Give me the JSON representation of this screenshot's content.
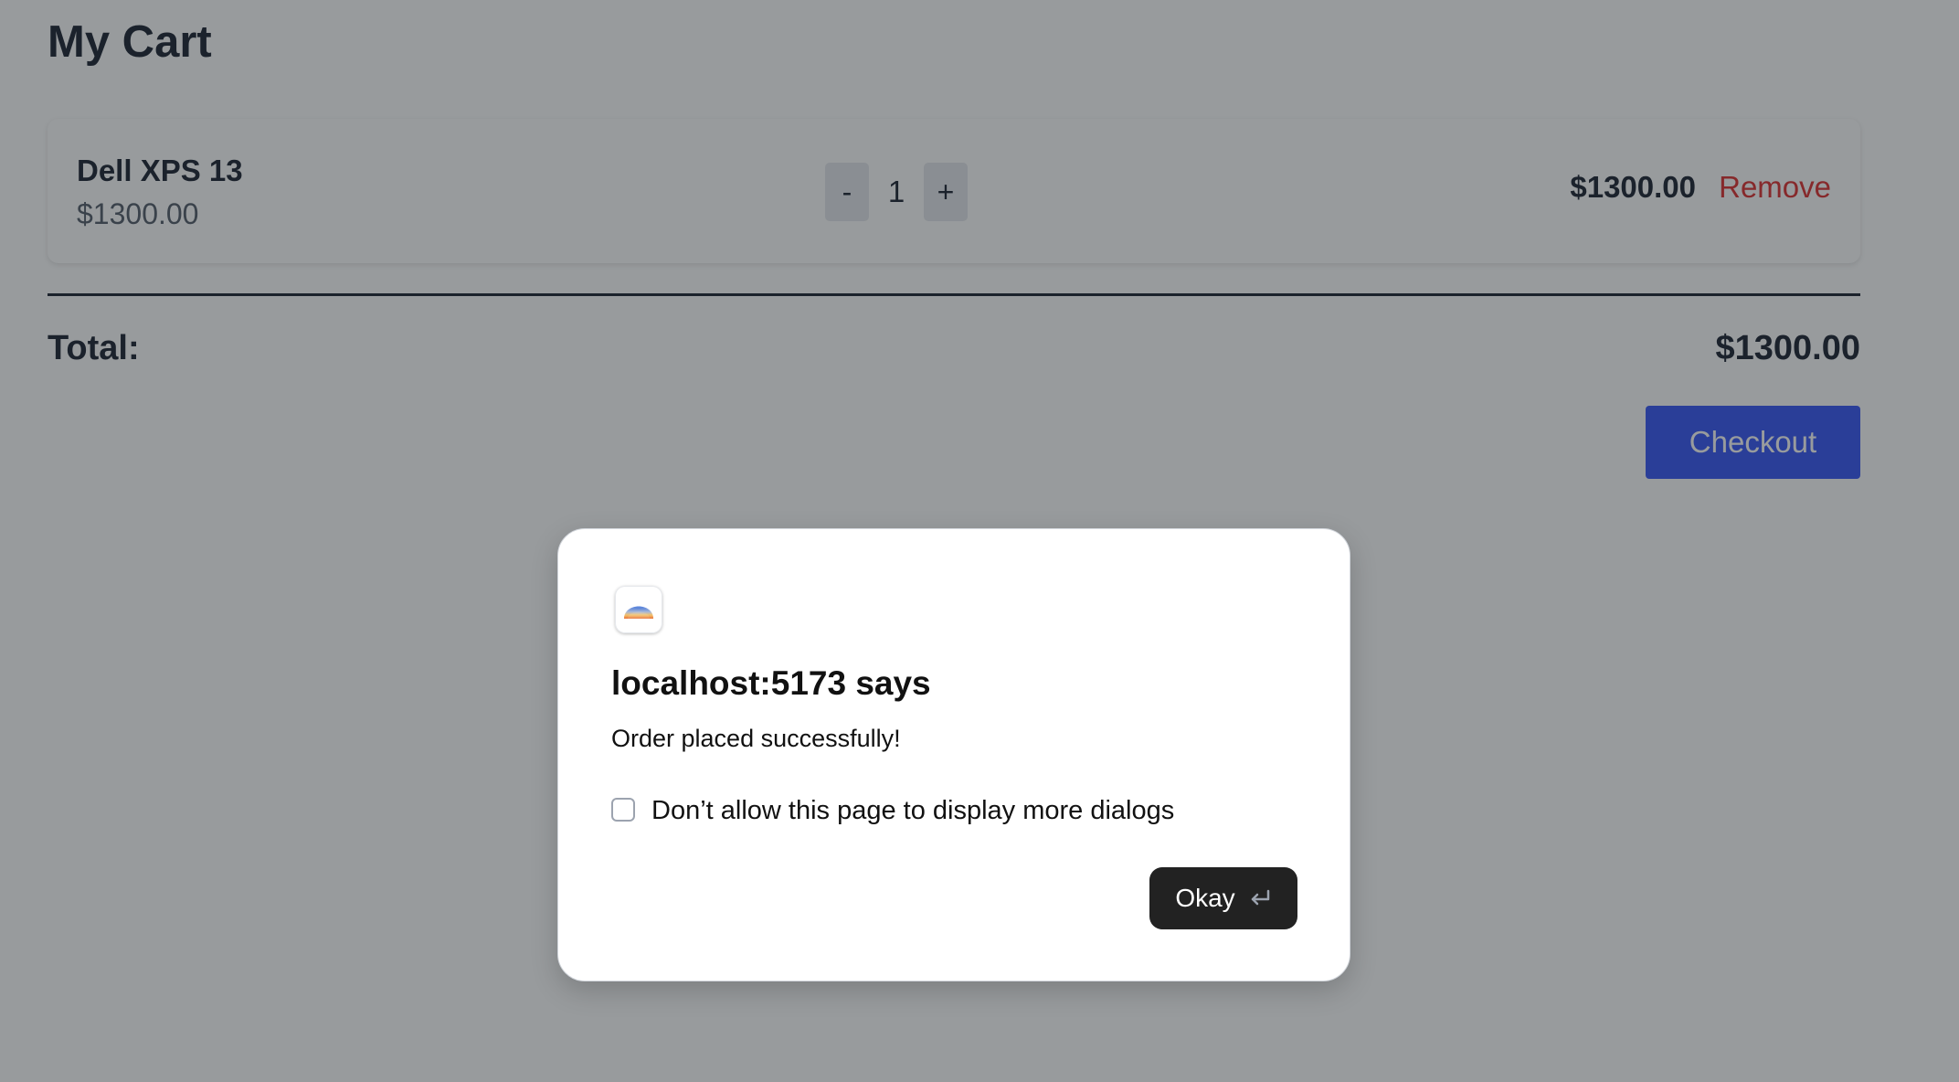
{
  "page": {
    "title": "My Cart"
  },
  "cart": {
    "items": [
      {
        "name": "Dell XPS 13",
        "unit_price": "$1300.00",
        "quantity": "1",
        "line_total": "$1300.00",
        "remove_label": "Remove"
      }
    ],
    "decrement_label": "-",
    "increment_label": "+",
    "total_label": "Total:",
    "total_value": "$1300.00",
    "checkout_label": "Checkout"
  },
  "dialog": {
    "icon": "browser-app-icon",
    "title": "localhost:5173 says",
    "message": "Order placed successfully!",
    "checkbox_label": "Don’t allow this page to display more dialogs",
    "checkbox_checked": false,
    "ok_label": "Okay",
    "ok_icon": "return-key-icon"
  },
  "colors": {
    "checkout_button": "#2d4ef5",
    "remove_link": "#dc2626",
    "overlay": "rgba(40,45,50,0.48)",
    "ok_button": "#222222"
  }
}
